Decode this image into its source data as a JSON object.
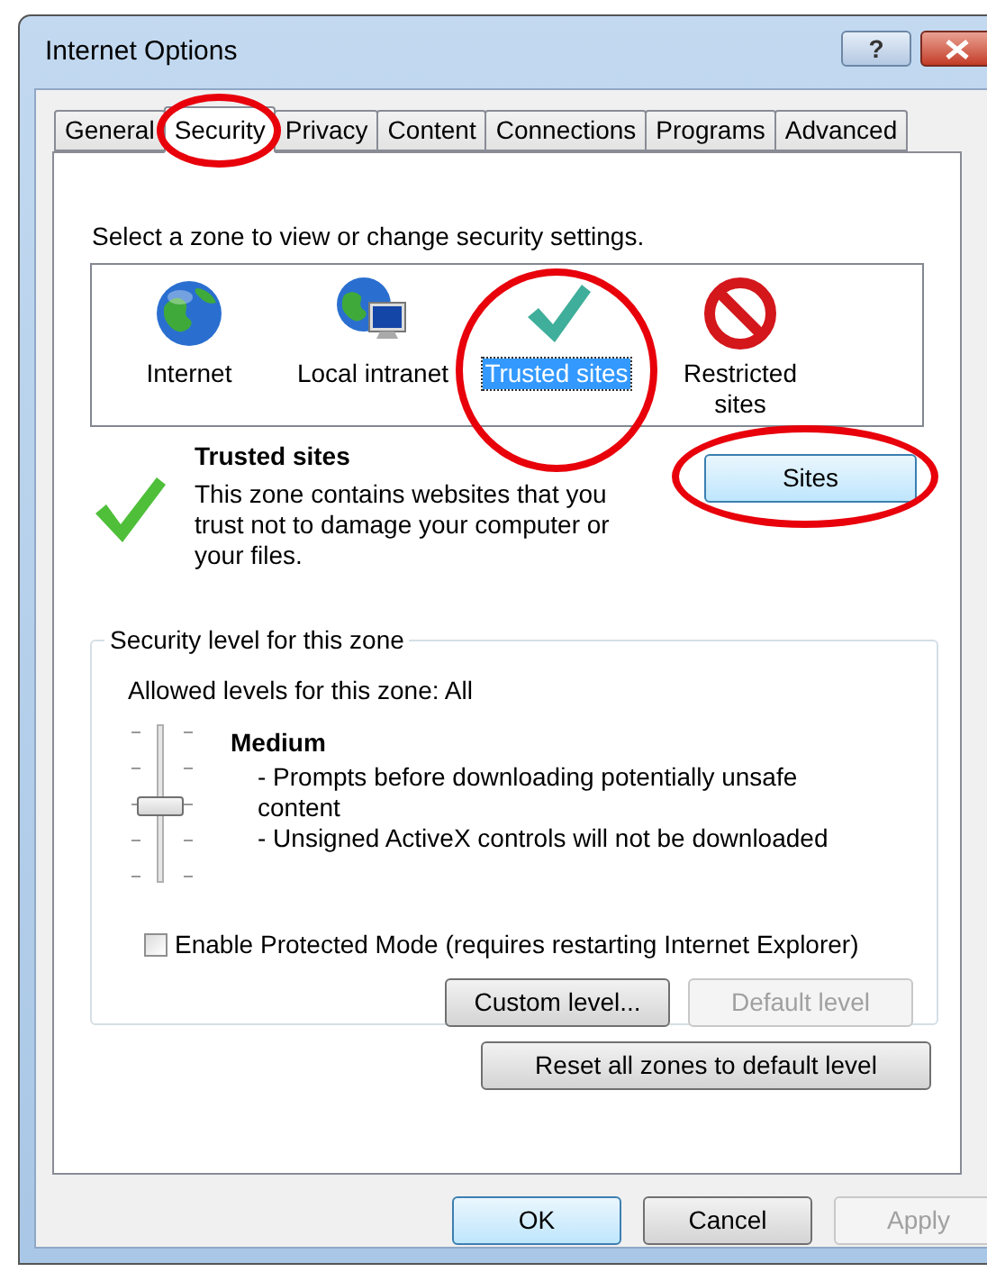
{
  "window": {
    "title": "Internet Options"
  },
  "title_buttons": [
    {
      "kind": "help",
      "label": "?"
    },
    {
      "kind": "close"
    }
  ],
  "tabs": [
    {
      "label": "General",
      "selected": false,
      "circled": false
    },
    {
      "label": "Security",
      "selected": true,
      "circled": true
    },
    {
      "label": "Privacy",
      "selected": false,
      "circled": false
    },
    {
      "label": "Content",
      "selected": false,
      "circled": false
    },
    {
      "label": "Connections",
      "selected": false,
      "circled": false
    },
    {
      "label": "Programs",
      "selected": false,
      "circled": false
    },
    {
      "label": "Advanced",
      "selected": false,
      "circled": false
    }
  ],
  "zones": {
    "instruction": "Select a zone to view or change security settings.",
    "items": [
      {
        "kind": "internet",
        "label": "Internet",
        "selected": false,
        "circled": false
      },
      {
        "kind": "intranet",
        "label": "Local intranet",
        "selected": false,
        "circled": false
      },
      {
        "kind": "trusted",
        "label": "Trusted sites",
        "selected": true,
        "circled": true
      },
      {
        "kind": "restricted",
        "label": "Restricted sites",
        "selected": false,
        "circled": false
      }
    ]
  },
  "zone_info": {
    "title": "Trusted sites",
    "description": "This zone contains websites that you trust not to damage your computer or your files."
  },
  "sites_button": {
    "label": "Sites",
    "default": true,
    "circled": true
  },
  "security_level": {
    "legend": "Security level for this zone",
    "allowed": "Allowed levels for this zone: All",
    "slider": {
      "level": 0.5
    },
    "level_name": "Medium",
    "bullets": [
      "- Prompts before downloading potentially unsafe content",
      "- Unsigned ActiveX controls will not be downloaded"
    ],
    "protected_mode": {
      "label": "Enable Protected Mode (requires restarting Internet Explorer)",
      "checked": false
    },
    "buttons": [
      {
        "label": "Custom level...",
        "disabled": false
      },
      {
        "label": "Default level",
        "disabled": true
      }
    ]
  },
  "reset_button": {
    "label": "Reset all zones to default level",
    "disabled": false
  },
  "footer_buttons": [
    {
      "label": "OK",
      "default": true,
      "disabled": false
    },
    {
      "label": "Cancel",
      "default": false,
      "disabled": false
    },
    {
      "label": "Apply",
      "default": false,
      "disabled": true
    }
  ]
}
